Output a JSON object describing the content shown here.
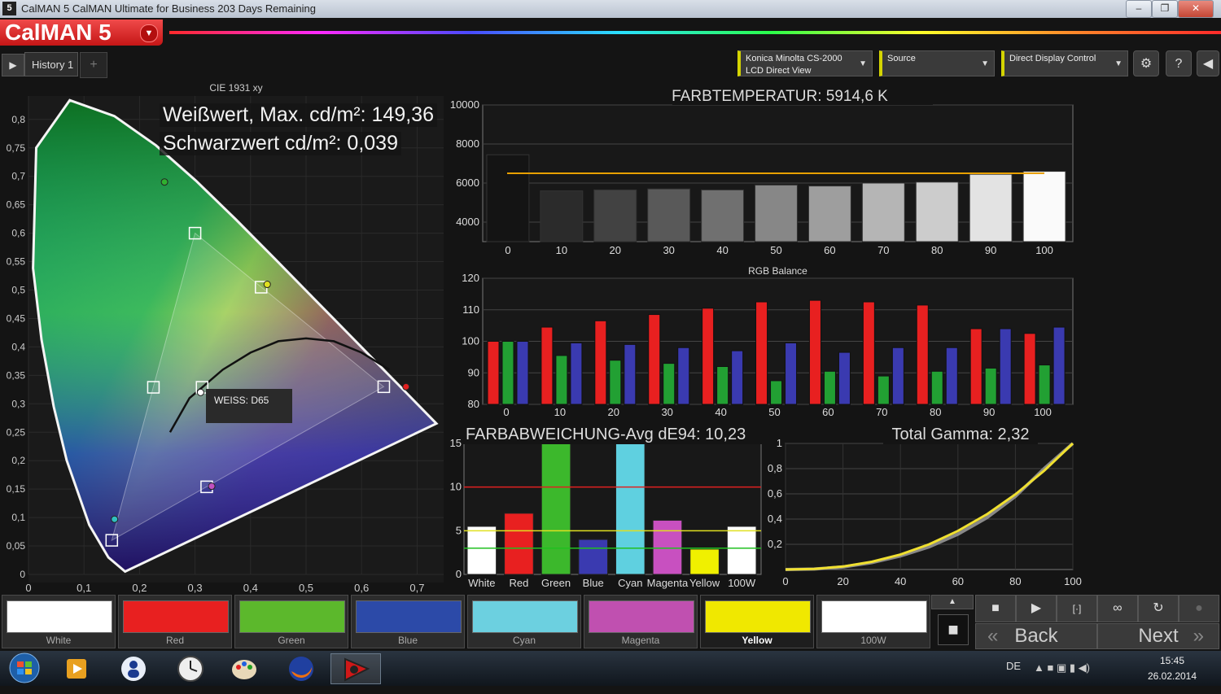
{
  "window": {
    "app_icon": "5",
    "title": "CalMAN 5 CalMAN Ultimate for Business 203 Days Remaining",
    "minimize": "–",
    "maximize": "❐",
    "close": "✕"
  },
  "logo": {
    "name": "CalMAN 5",
    "dropdown": "▼"
  },
  "tabs": {
    "play": "▶",
    "history": "History 1",
    "add": "+"
  },
  "toolbar": {
    "meter_line1": "Konica Minolta CS-2000",
    "meter_line2": "LCD Direct View",
    "source": "Source",
    "display": "Direct Display Control",
    "dropdown_arrow": "▼",
    "settings_glyph": "⚙",
    "help_glyph": "?",
    "collapse_glyph": "◀",
    "accent": "#d4d400"
  },
  "cie": {
    "title": "CIE 1931 xy",
    "white_max": "Weißwert, Max. cd/m²: 149,36",
    "black": "Schwarzwert cd/m²: 0,039",
    "white_label": "WEISS: D65",
    "x_ticks": [
      "0",
      "0,1",
      "0,2",
      "0,3",
      "0,4",
      "0,5",
      "0,6",
      "0,7"
    ],
    "y_ticks": [
      "0",
      "0,05",
      "0,1",
      "0,15",
      "0,2",
      "0,25",
      "0,3",
      "0,35",
      "0,4",
      "0,45",
      "0,5",
      "0,55",
      "0,6",
      "0,65",
      "0,7",
      "0,75",
      "0,8"
    ]
  },
  "chart_data": [
    {
      "type": "bar",
      "title": "FARBTEMPERATUR: 5914,6 K",
      "categories": [
        "0",
        "10",
        "20",
        "30",
        "40",
        "50",
        "60",
        "70",
        "80",
        "90",
        "100"
      ],
      "values": [
        7450,
        5600,
        5650,
        5700,
        5650,
        5900,
        5850,
        6000,
        6050,
        6450,
        6600
      ],
      "ylim": [
        3000,
        10000
      ],
      "y_ticks": [
        "4000",
        "6000",
        "8000",
        "10000"
      ],
      "target": 6500
    },
    {
      "type": "bar",
      "title": "RGB Balance",
      "categories": [
        "0",
        "10",
        "20",
        "30",
        "40",
        "50",
        "60",
        "70",
        "80",
        "90",
        "100"
      ],
      "series": [
        {
          "color": "#e82020",
          "values": [
            100,
            104.5,
            106.5,
            108.5,
            110.5,
            112.5,
            113,
            112.5,
            111.5,
            104,
            102.5
          ]
        },
        {
          "color": "#22a033",
          "values": [
            100,
            95.5,
            94,
            93,
            92,
            87.5,
            90.5,
            89,
            90.5,
            91.5,
            92.5
          ]
        },
        {
          "color": "#3a3ab0",
          "values": [
            100,
            99.5,
            99,
            98,
            97,
            99.5,
            96.5,
            98,
            98,
            104,
            104.5
          ]
        }
      ],
      "ylim": [
        80,
        120
      ],
      "y_ticks": [
        "80",
        "90",
        "100",
        "110",
        "120"
      ]
    },
    {
      "type": "bar",
      "title": "FARBABWEICHUNG-Avg dE94: 10,23",
      "categories": [
        "White",
        "Red",
        "Green",
        "Blue",
        "Cyan",
        "Magenta",
        "Yellow",
        "100W"
      ],
      "values": [
        5.5,
        7,
        15,
        4,
        15,
        6.2,
        2.9,
        5.5
      ],
      "colors": [
        "#ffffff",
        "#e82020",
        "#3cb82c",
        "#3a3ab0",
        "#5fd0e0",
        "#c850c0",
        "#f0f000",
        "#ffffff"
      ],
      "ylim": [
        0,
        15
      ],
      "y_ticks": [
        "0",
        "5",
        "10",
        "15"
      ],
      "thresholds": [
        {
          "value": 10,
          "color": "#e02020"
        },
        {
          "value": 5,
          "color": "#e0e020"
        },
        {
          "value": 3,
          "color": "#20c020"
        }
      ]
    },
    {
      "type": "line",
      "title": "Total Gamma: 2,32",
      "x": [
        0,
        10,
        20,
        30,
        40,
        50,
        60,
        70,
        80,
        90,
        100
      ],
      "series": [
        {
          "color": "#f0e030",
          "values": [
            0,
            0.005,
            0.024,
            0.061,
            0.119,
            0.2,
            0.306,
            0.437,
            0.596,
            0.783,
            1.0
          ]
        },
        {
          "color": "#888888",
          "values": [
            0,
            0.004,
            0.02,
            0.055,
            0.108,
            0.18,
            0.28,
            0.41,
            0.58,
            0.8,
            1.0
          ]
        }
      ],
      "xlim": [
        0,
        100
      ],
      "ylim": [
        0,
        1
      ],
      "x_ticks": [
        "0",
        "20",
        "40",
        "60",
        "80",
        "100"
      ],
      "y_ticks": [
        "0,2",
        "0,4",
        "0,6",
        "0,8",
        "1"
      ]
    }
  ],
  "swatches": [
    {
      "label": "White",
      "color": "#ffffff"
    },
    {
      "label": "Red",
      "color": "#e82020"
    },
    {
      "label": "Green",
      "color": "#5cb82c"
    },
    {
      "label": "Blue",
      "color": "#2c4aa8"
    },
    {
      "label": "Cyan",
      "color": "#6cd0e0"
    },
    {
      "label": "Magenta",
      "color": "#c050b0"
    },
    {
      "label": "Yellow",
      "color": "#f0e800"
    },
    {
      "label": "100W",
      "color": "#ffffff"
    }
  ],
  "controls": {
    "up": "▲",
    "stop": "■",
    "stop2": "■",
    "play": "▶",
    "fit": "[·]",
    "loop": "∞",
    "refresh": "↻",
    "record": "●",
    "back": "Back",
    "next": "Next",
    "back_glyph": "«",
    "next_glyph": "»"
  },
  "taskbar": {
    "lang": "DE",
    "time": "15:45",
    "date": "26.02.2014",
    "tray": "▲ ■ ▣ ▮ ◀)"
  }
}
